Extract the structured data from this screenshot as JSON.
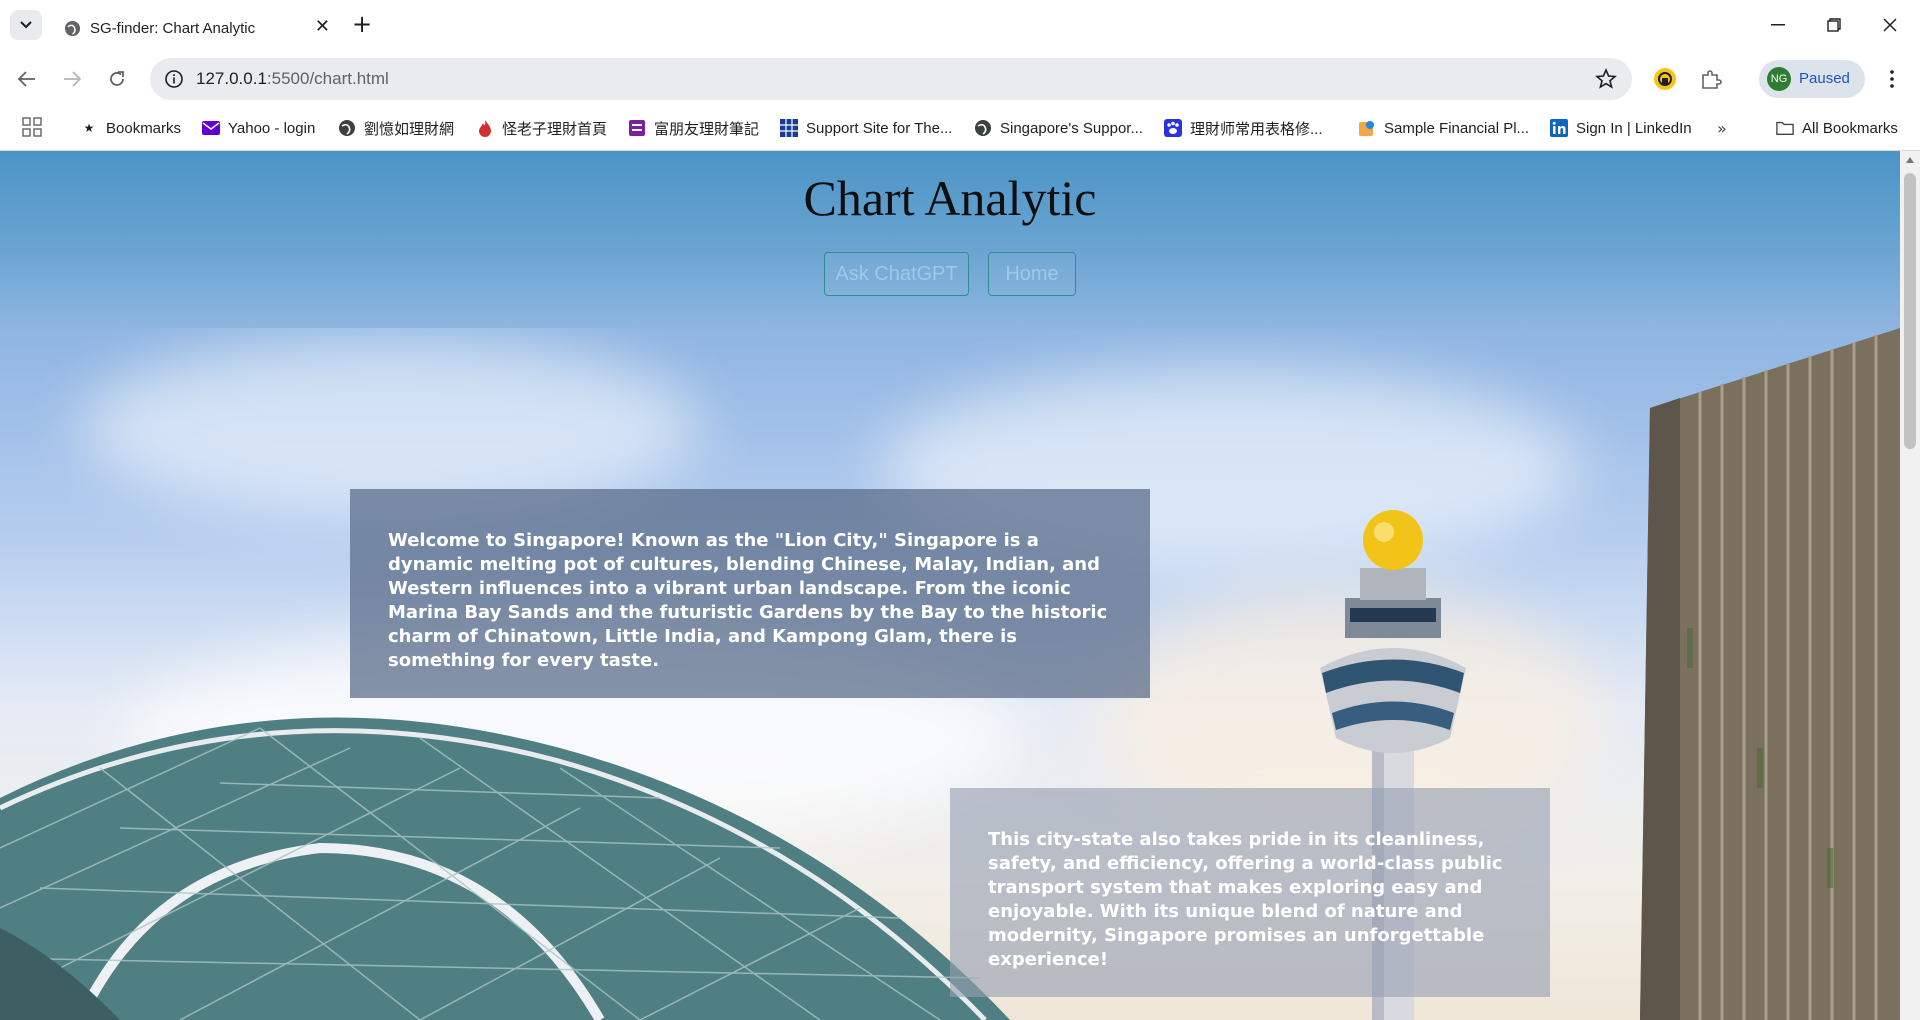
{
  "browser": {
    "tab": {
      "title": "SG-finder: Chart Analytic"
    },
    "address_bar": {
      "host": "127.0.0.1",
      "path": ":5500/chart.html"
    },
    "profile": {
      "initials": "NG",
      "status": "Paused"
    },
    "bookmarks": [
      {
        "label": "Bookmarks",
        "icon": "star-icon"
      },
      {
        "label": "Yahoo - login",
        "icon": "mail-icon"
      },
      {
        "label": "劉憶如理財網",
        "icon": "globe-icon"
      },
      {
        "label": "怪老子理財首頁",
        "icon": "fire-icon"
      },
      {
        "label": "富朋友理財筆記",
        "icon": "book-icon"
      },
      {
        "label": "Support Site for The...",
        "icon": "grid-icon"
      },
      {
        "label": "Singapore's Suppor...",
        "icon": "globe-icon"
      },
      {
        "label": "理財师常用表格修...",
        "icon": "paw-icon"
      },
      {
        "label": "Sample Financial Pl...",
        "icon": "finance-icon"
      },
      {
        "label": "Sign In | LinkedIn",
        "icon": "linkedin-icon"
      }
    ],
    "all_bookmarks_label": "All Bookmarks"
  },
  "page": {
    "title": "Chart Analytic",
    "nav": {
      "ask_label": "Ask ChatGPT",
      "home_label": "Home"
    },
    "intro_text": "Welcome to Singapore! Known as the \"Lion City,\" Singapore is a dynamic melting pot of cultures, blending Chinese, Malay, Indian, and Western influences into a vibrant urban landscape. From the iconic Marina Bay Sands and the futuristic Gardens by the Bay to the historic charm of Chinatown, Little India, and Kampong Glam, there is something for every taste.",
    "secondary_text": "This city-state also takes pride in its cleanliness, safety, and efficiency, offering a world-class public transport system that makes exploring easy and enjoyable. With its unique blend of nature and modernity, Singapore promises an unforgettable experience!"
  },
  "colors": {
    "header_top": "#4c94c6",
    "header_bottom": "#8eb5e0",
    "button_border": "#2f8f8f",
    "button_text": "#9fc9e8"
  }
}
